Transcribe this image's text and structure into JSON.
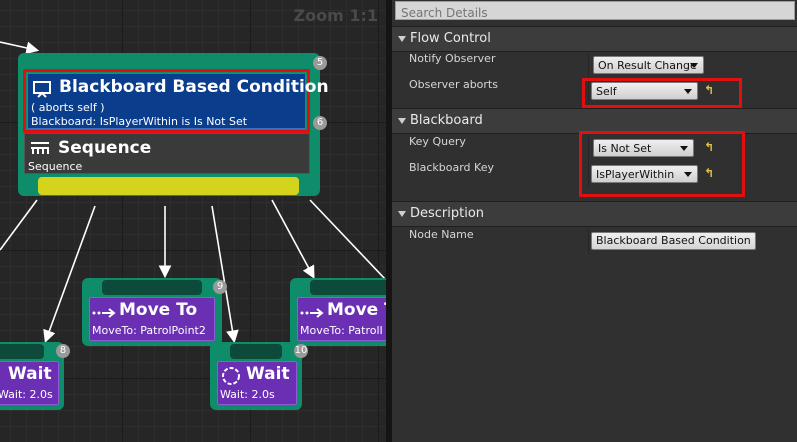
{
  "graph": {
    "zoom_label": "Zoom 1:1",
    "decorator": {
      "title": "Blackboard Based Condition",
      "aborts": "( aborts self )",
      "description": "Blackboard: IsPlayerWithin is Is Not Set",
      "index": "6"
    },
    "sequence": {
      "title": "Sequence",
      "subtitle": "Sequence",
      "index": "5"
    },
    "tasks": [
      {
        "title": "Move To",
        "subtitle": "MoveTo: PatrolPoint2",
        "index": "9"
      },
      {
        "title": "Move T",
        "subtitle": "MoveTo: PatrolI",
        "index": ""
      },
      {
        "title": "Wait",
        "subtitle": "Wait: 2.0s",
        "index": "10"
      },
      {
        "title": "Wait",
        "subtitle": "Wait: 2.0s",
        "index": "8"
      }
    ]
  },
  "details": {
    "search_placeholder": "Search Details",
    "categories": {
      "flow_control": "Flow Control",
      "blackboard": "Blackboard",
      "description": "Description"
    },
    "rows": {
      "notify_observer": {
        "label": "Notify Observer",
        "value": "On Result Change"
      },
      "observer_aborts": {
        "label": "Observer aborts",
        "value": "Self"
      },
      "key_query": {
        "label": "Key Query",
        "value": "Is Not Set"
      },
      "blackboard_key": {
        "label": "Blackboard Key",
        "value": "IsPlayerWithin"
      },
      "node_name": {
        "label": "Node Name",
        "value": "Blackboard Based Condition"
      }
    },
    "reset_glyph": "↰"
  },
  "colors": {
    "node_green": "#0f8c6a",
    "decorator_blue": "#0a3d8c",
    "task_purple": "#6b2fb3",
    "highlight_red": "#e01010",
    "sequence_yellow": "#d4d41c"
  }
}
